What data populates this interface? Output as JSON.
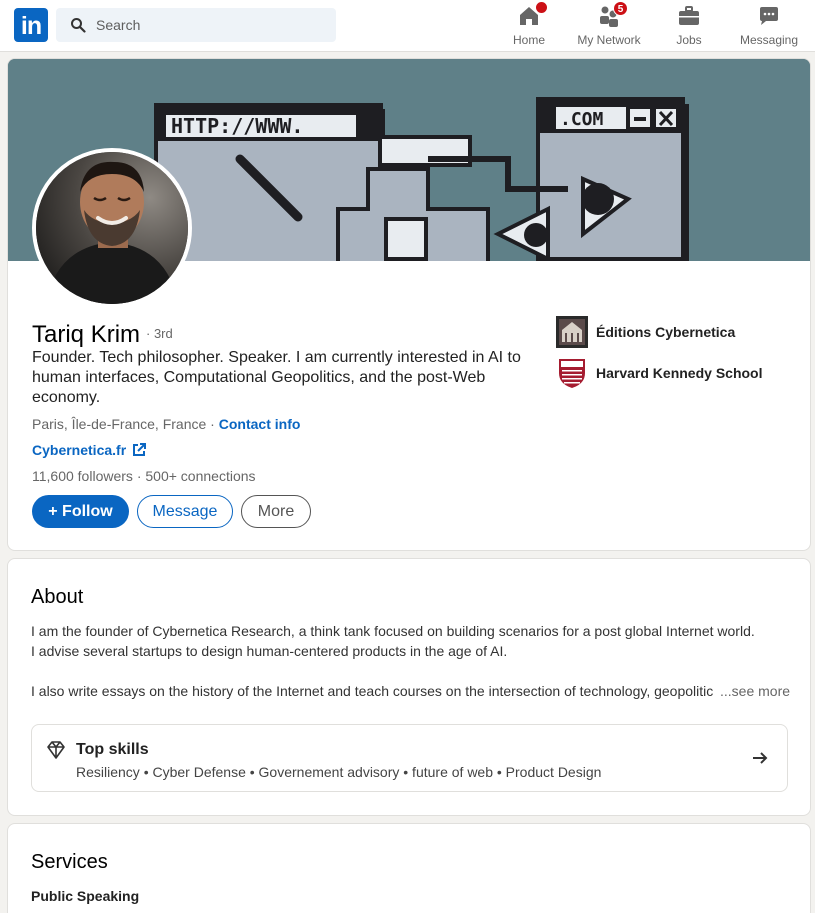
{
  "nav": {
    "logo_text": "in",
    "search_placeholder": "Search",
    "items": [
      {
        "label": "Home",
        "icon": "home-icon"
      },
      {
        "label": "My Network",
        "icon": "network-icon",
        "badge": "5"
      },
      {
        "label": "Jobs",
        "icon": "briefcase-icon"
      },
      {
        "label": "Messaging",
        "icon": "chat-icon"
      }
    ]
  },
  "profile": {
    "banner_text": {
      "url": "HTTP://WWW.",
      "com": ".COM"
    },
    "name": "Tariq Krim",
    "degree": "· 3rd",
    "headline": "Founder. Tech philosopher. Speaker. I am currently interested in AI to human interfaces, Computational Geopolitics, and the post-Web economy.",
    "location": "Paris, Île-de-France, France",
    "location_sep": " · ",
    "contact_label": "Contact info",
    "website": "Cybernetica.fr",
    "followers": "11,600 followers",
    "connections": "500+ connections",
    "follow_label": "+ Follow",
    "message_label": "Message",
    "more_label": "More",
    "orgs": [
      {
        "name": "Éditions Cybernetica"
      },
      {
        "name": "Harvard Kennedy School"
      }
    ]
  },
  "about": {
    "title": "About",
    "lines": [
      "I am the founder of Cybernetica Research, a think tank focused on building scenarios for a post global Internet world.",
      "I advise several startups to design human-centered products in the age of AI.",
      "I also write essays on the history of the Internet and teach courses on the intersection of technology, geopolitic"
    ],
    "see_more": "...see more",
    "top_skills_title": "Top skills",
    "top_skills": "Resiliency • Cyber Defense • Governement advisory • future of web • Product Design"
  },
  "services": {
    "title": "Services",
    "first_item": "Public Speaking"
  },
  "colors": {
    "brand": "#0a66c2",
    "badge": "#cc1016",
    "banner": "#5f8088"
  }
}
